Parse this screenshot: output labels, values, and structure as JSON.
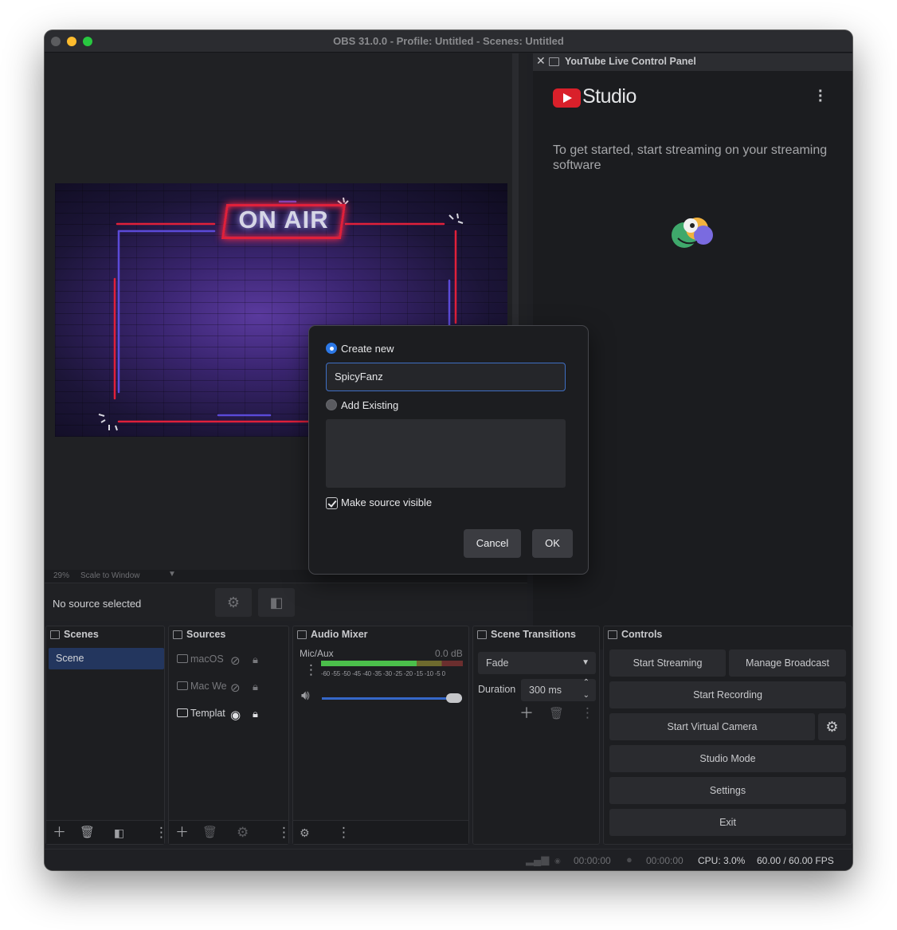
{
  "window": {
    "title": "OBS 31.0.0 - Profile: Untitled - Scenes: Untitled"
  },
  "preview": {
    "overlay_text": "ON AIR",
    "zoom": "29%",
    "scale_mode": "Scale to Window",
    "no_source": "No source selected"
  },
  "youtube_panel": {
    "title": "YouTube Live Control Panel",
    "brand": "Studio",
    "message": "To get started, start streaming on your streaming software"
  },
  "dialog": {
    "create_new_label": "Create new",
    "name_value": "SpicyFanz",
    "add_existing_label": "Add Existing",
    "make_visible_label": "Make source visible",
    "cancel_label": "Cancel",
    "ok_label": "OK"
  },
  "scenes": {
    "title": "Scenes",
    "items": [
      "Scene"
    ]
  },
  "sources": {
    "title": "Sources",
    "items": [
      "macOS",
      "Mac We",
      "Templat"
    ]
  },
  "audio_mixer": {
    "title": "Audio Mixer",
    "channel": "Mic/Aux",
    "level": "0.0 dB",
    "scale": "-60 -55 -50 -45 -40 -35 -30 -25 -20 -15 -10 -5 0"
  },
  "transitions": {
    "title": "Scene Transitions",
    "selected": "Fade",
    "duration_label": "Duration",
    "duration_value": "300 ms"
  },
  "controls": {
    "title": "Controls",
    "start_streaming": "Start Streaming",
    "manage_broadcast": "Manage Broadcast",
    "start_recording": "Start Recording",
    "start_virtual_camera": "Start Virtual Camera",
    "studio_mode": "Studio Mode",
    "settings": "Settings",
    "exit": "Exit"
  },
  "status": {
    "stream_time": "00:00:00",
    "record_time": "00:00:00",
    "cpu": "CPU: 3.0%",
    "fps": "60.00 / 60.00 FPS"
  },
  "colors": {
    "accent": "#2c78e6",
    "selected_scene": "#23365e",
    "youtube_red": "#d9202a"
  }
}
